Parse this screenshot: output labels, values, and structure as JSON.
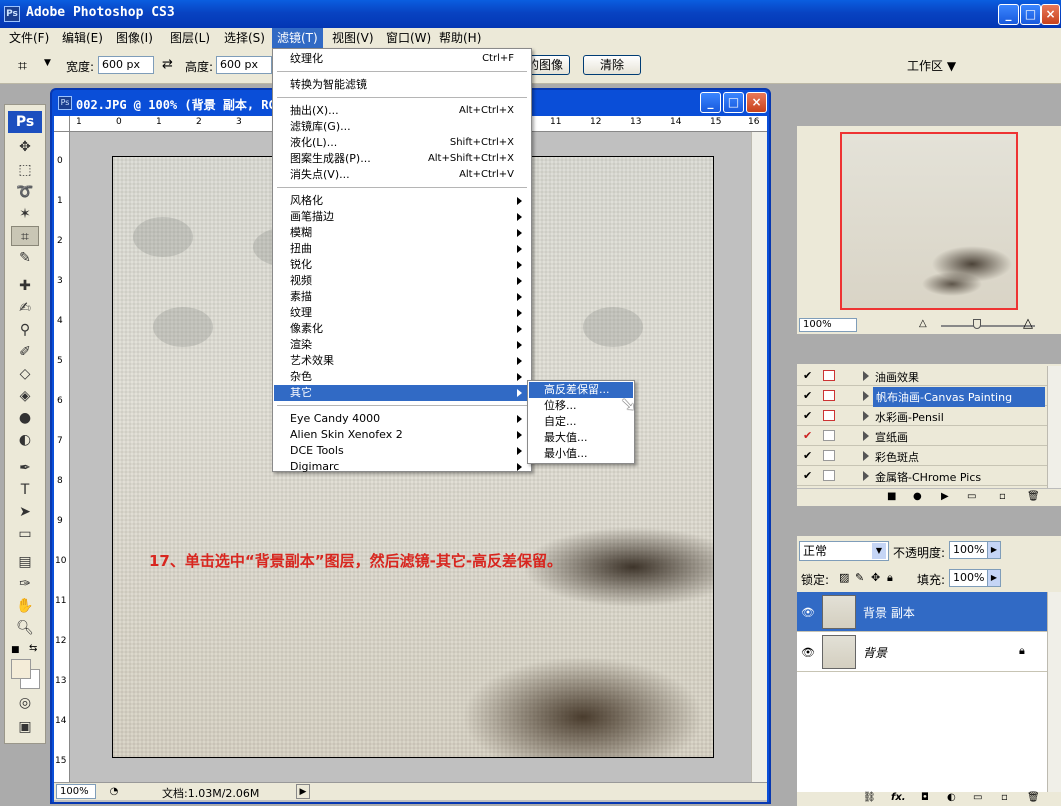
{
  "app": {
    "title": "Adobe Photoshop CS3",
    "logo_text": "Ps"
  },
  "menubar": {
    "items": [
      "文件(F)",
      "编辑(E)",
      "图像(I)",
      "图层(L)",
      "选择(S)",
      "滤镜(T)",
      "视图(V)",
      "窗口(W)",
      "帮助(H)"
    ],
    "active_index": 5
  },
  "options_bar": {
    "width_label": "宽度:",
    "width_value": "600 px",
    "height_label": "高度:",
    "height_value": "600 px",
    "front_image_label": "前面的图像",
    "clear_label": "清除",
    "workspace_label": "工作区"
  },
  "tools_panel": {
    "logo": "Ps"
  },
  "document": {
    "title": "002.JPG @ 100% (背景 副本, RGB/8#)",
    "ruler_h": [
      "1",
      "0",
      "1",
      "2",
      "3",
      "11",
      "12",
      "13",
      "14",
      "15",
      "16"
    ],
    "ruler_v": [
      "0",
      "1",
      "2",
      "3",
      "4",
      "5",
      "6",
      "7",
      "8",
      "9",
      "10",
      "11",
      "12",
      "13",
      "14",
      "15"
    ],
    "zoom": "100%",
    "doc_size": "文档:1.03M/2.06M",
    "instruction": "17、单击选中“背景副本”图层，然后滤镜-其它-高反差保留。"
  },
  "filter_menu": {
    "groups": [
      [
        {
          "label": "纹理化",
          "shortcut": "Ctrl+F"
        }
      ],
      [
        {
          "label": "转换为智能滤镜"
        }
      ],
      [
        {
          "label": "抽出(X)...",
          "shortcut": "Alt+Ctrl+X"
        },
        {
          "label": "滤镜库(G)..."
        },
        {
          "label": "液化(L)...",
          "shortcut": "Shift+Ctrl+X"
        },
        {
          "label": "图案生成器(P)...",
          "shortcut": "Alt+Shift+Ctrl+X"
        },
        {
          "label": "消失点(V)...",
          "shortcut": "Alt+Ctrl+V"
        }
      ],
      [
        {
          "label": "风格化",
          "submenu": true
        },
        {
          "label": "画笔描边",
          "submenu": true
        },
        {
          "label": "模糊",
          "submenu": true
        },
        {
          "label": "扭曲",
          "submenu": true
        },
        {
          "label": "锐化",
          "submenu": true
        },
        {
          "label": "视频",
          "submenu": true
        },
        {
          "label": "素描",
          "submenu": true
        },
        {
          "label": "纹理",
          "submenu": true
        },
        {
          "label": "像素化",
          "submenu": true
        },
        {
          "label": "渲染",
          "submenu": true
        },
        {
          "label": "艺术效果",
          "submenu": true
        },
        {
          "label": "杂色",
          "submenu": true
        },
        {
          "label": "其它",
          "submenu": true,
          "highlighted": true
        }
      ],
      [
        {
          "label": "Eye Candy 4000",
          "submenu": true
        },
        {
          "label": "Alien Skin Xenofex 2",
          "submenu": true
        },
        {
          "label": "DCE Tools",
          "submenu": true
        },
        {
          "label": "Digimarc",
          "submenu": true
        }
      ]
    ]
  },
  "other_submenu": {
    "items": [
      "高反差保留...",
      "位移...",
      "自定...",
      "最大值...",
      "最小值..."
    ],
    "highlighted_index": 0
  },
  "navigator": {
    "zoom": "100%"
  },
  "actions": {
    "items": [
      {
        "label": "油画效果",
        "box_red": true
      },
      {
        "label": "帆布油画-Canvas Painting",
        "box_red": true,
        "selected": true
      },
      {
        "label": "水彩画-Pensil",
        "box_red": true
      },
      {
        "label": "宣纸画",
        "box_red": false,
        "check_red": true
      },
      {
        "label": "彩色斑点",
        "box_red": false
      },
      {
        "label": "金属铬-CHrome Pics",
        "box_red": false
      }
    ]
  },
  "layers": {
    "blend_mode": "正常",
    "opacity_label": "不透明度:",
    "opacity_value": "100%",
    "lock_label": "锁定:",
    "fill_label": "填充:",
    "fill_value": "100%",
    "items": [
      {
        "name": "背景 副本",
        "selected": true
      },
      {
        "name": "背景",
        "selected": false,
        "locked": true
      }
    ],
    "footer_fx": "fx."
  },
  "colors": {
    "accent": "#316ac5",
    "instruction_text": "#d8261f",
    "titlebar": "#0843c2"
  }
}
